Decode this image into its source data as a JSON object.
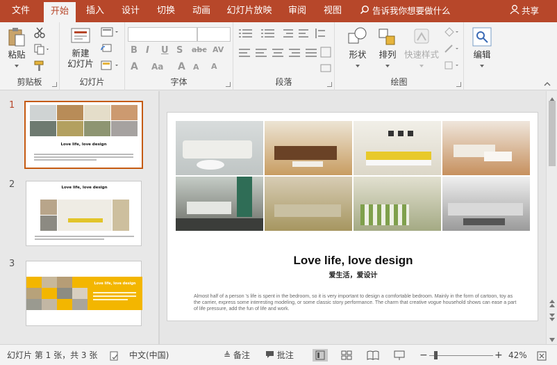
{
  "tabs": [
    "文件",
    "开始",
    "插入",
    "设计",
    "切换",
    "动画",
    "幻灯片放映",
    "审阅",
    "视图"
  ],
  "active_tab": "开始",
  "tell_me": "告诉我你想要做什么",
  "share": "共享",
  "ribbon": {
    "clipboard": {
      "paste": "粘贴",
      "label": "剪贴板"
    },
    "slides": {
      "new_slide_line1": "新建",
      "new_slide_line2": "幻灯片",
      "label": "幻灯片"
    },
    "font": {
      "label": "字体"
    },
    "paragraph": {
      "label": "段落"
    },
    "drawing": {
      "shape": "形状",
      "arrange": "排列",
      "quick_styles": "快速样式",
      "label": "绘图"
    },
    "editing": {
      "edit": "编辑"
    }
  },
  "thumbnails": [
    {
      "number": "1",
      "title": "Love life, love design",
      "selected": true
    },
    {
      "number": "2",
      "title": "Love life, love design",
      "selected": false
    },
    {
      "number": "3",
      "title": "Love life, love design",
      "selected": false
    }
  ],
  "slide": {
    "title": "Love life, love design",
    "subtitle": "爱生活，爱设计",
    "body": "Almost half of a person 's life is spent in the bedroom, so it is very important to design a comfortable bedroom. Mainly in the form of cartoon, toy as the carrier, express some interesting modeling, or some classic story performance. The charm that creative vogue household shows can ease a part of life pressure, add the fun of life and work."
  },
  "status": {
    "slide_info": "幻灯片 第 1 张，共 3 张",
    "language": "中文(中国)",
    "notes": "备注",
    "comments": "批注",
    "zoom": "42%"
  },
  "colors": {
    "accent": "#b7472a",
    "selection": "#c55a11"
  }
}
